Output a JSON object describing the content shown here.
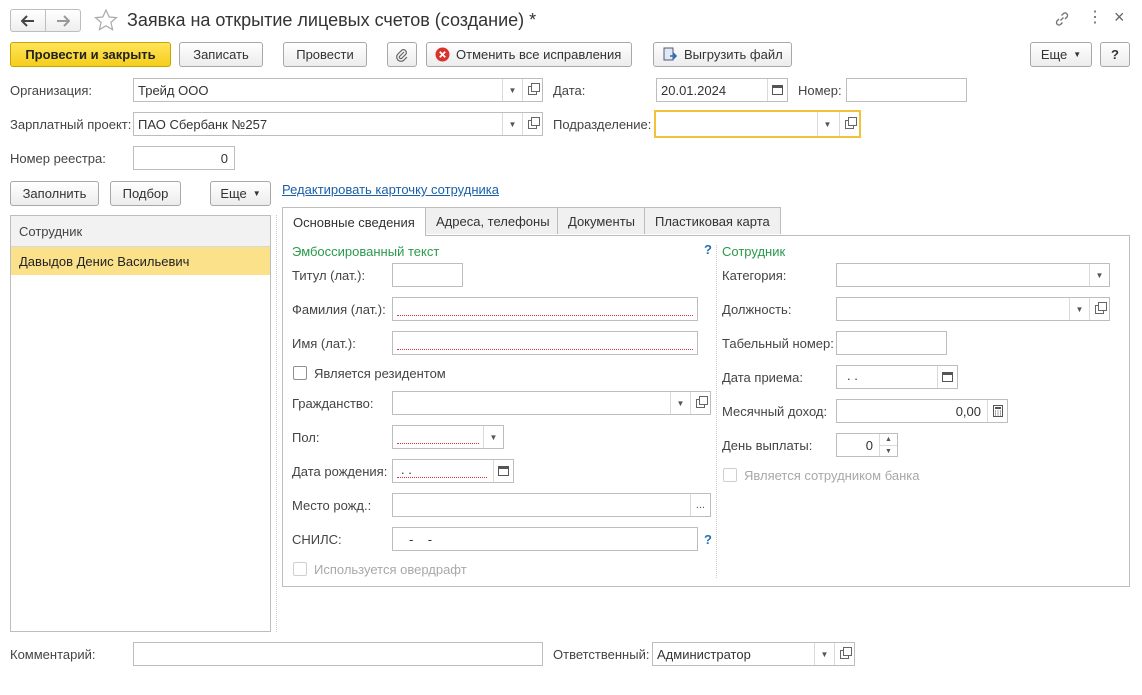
{
  "window": {
    "title": "Заявка на открытие лицевых счетов (создание) *"
  },
  "toolbar": {
    "post_close": "Провести и закрыть",
    "write": "Записать",
    "post": "Провести",
    "cancel_fixes": "Отменить все исправления",
    "export_file": "Выгрузить файл",
    "more": "Еще",
    "help": "?"
  },
  "header": {
    "org_label": "Организация:",
    "org_value": "Трейд ООО",
    "date_label": "Дата:",
    "date_value": "20.01.2024",
    "number_label": "Номер:",
    "number_value": "",
    "salary_label": "Зарплатный проект:",
    "salary_value": "ПАО Сбербанк №257",
    "division_label": "Подразделение:",
    "division_value": "",
    "registry_label": "Номер реестра:",
    "registry_value": "0"
  },
  "list": {
    "fill": "Заполнить",
    "pick": "Подбор",
    "more": "Еще",
    "column": "Сотрудник",
    "rows": [
      "Давыдов Денис Васильевич"
    ]
  },
  "edit_link": "Редактировать карточку сотрудника",
  "tabs": [
    "Основные сведения",
    "Адреса, телефоны",
    "Документы",
    "Пластиковая карта"
  ],
  "emb": {
    "section": "Эмбоссированный текст",
    "help": "?",
    "title_label": "Титул (лат.):",
    "surname_label": "Фамилия (лат.):",
    "name_label": "Имя (лат.):",
    "resident_label": "Является резидентом",
    "citizenship_label": "Гражданство:",
    "gender_label": "Пол:",
    "birthdate_label": "Дата рождения:",
    "birthdate_value": " .  .",
    "birthplace_label": "Место рожд.:",
    "snils_label": "СНИЛС:",
    "snils_value": "-    -",
    "snils_help": "?",
    "overdraft_label": "Используется овердрафт"
  },
  "emp": {
    "section": "Сотрудник",
    "category_label": "Категория:",
    "position_label": "Должность:",
    "tabnum_label": "Табельный номер:",
    "hire_label": "Дата приема:",
    "hire_value": " .  .",
    "income_label": "Месячный доход:",
    "income_value": "0,00",
    "payday_label": "День выплаты:",
    "payday_value": "0",
    "bank_emp_label": "Является сотрудником банка"
  },
  "footer": {
    "comment_label": "Комментарий:",
    "comment_value": "",
    "responsible_label": "Ответственный:",
    "responsible_value": "Администратор"
  }
}
